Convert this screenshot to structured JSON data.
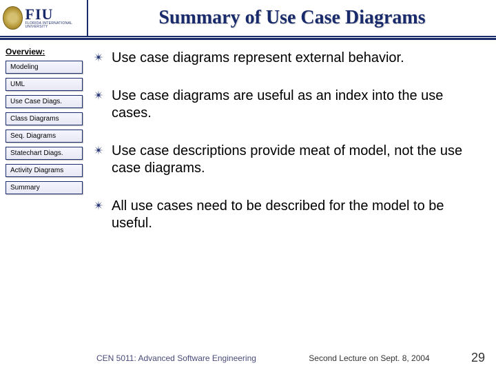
{
  "logo": {
    "abbr": "FIU",
    "sub": "FLORIDA INTERNATIONAL UNIVERSITY"
  },
  "title": "Summary of Use Case Diagrams",
  "sidebar": {
    "heading": "Overview:",
    "items": [
      "Modeling",
      "UML",
      "Use Case Diags.",
      "Class Diagrams",
      "Seq. Diagrams",
      "Statechart Diags.",
      "Activity Diagrams",
      "Summary"
    ]
  },
  "bullets": [
    "Use case diagrams represent external behavior.",
    "Use case diagrams are useful as an index into the use cases.",
    "Use case descriptions provide meat of model, not the use case diagrams.",
    "All use cases need to be described for the model to be useful."
  ],
  "footer": {
    "course": "CEN 5011: Advanced Software Engineering",
    "lecture": "Second Lecture on Sept. 8, 2004",
    "page": "29"
  }
}
